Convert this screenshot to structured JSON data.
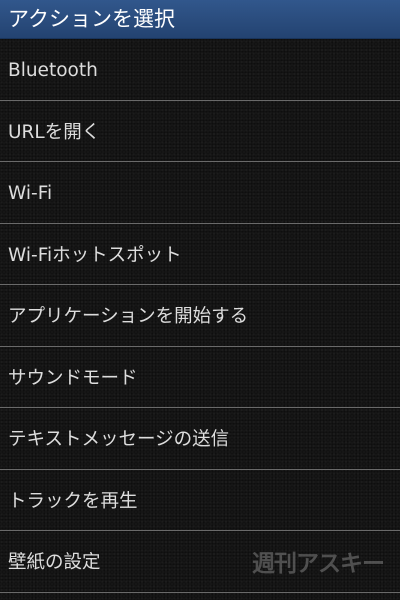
{
  "dialog": {
    "title": "アクションを選択"
  },
  "actions": [
    {
      "label": "Bluetooth"
    },
    {
      "label": "URLを開く"
    },
    {
      "label": "Wi-Fi"
    },
    {
      "label": "Wi-Fiホットスポット"
    },
    {
      "label": "アプリケーションを開始する"
    },
    {
      "label": "サウンドモード"
    },
    {
      "label": "テキストメッセージの送信"
    },
    {
      "label": "トラックを再生"
    },
    {
      "label": "壁紙の設定"
    }
  ],
  "watermark": {
    "text": "週刊アスキー"
  },
  "colors": {
    "title_bar": "#2a4c7d",
    "background": "#161616",
    "divider": "#6a6a6a",
    "text": "#dddddd"
  }
}
